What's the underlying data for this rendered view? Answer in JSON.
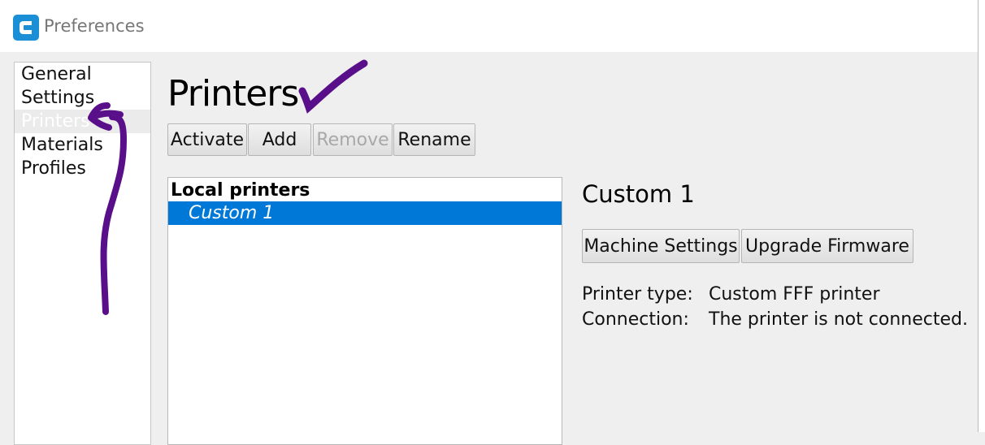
{
  "window": {
    "title": "Preferences"
  },
  "sidebar": {
    "items": [
      {
        "label": "General"
      },
      {
        "label": "Settings"
      },
      {
        "label": "Printers",
        "selected": true
      },
      {
        "label": "Materials"
      },
      {
        "label": "Profiles"
      }
    ]
  },
  "main": {
    "heading": "Printers",
    "toolbar": {
      "activate": "Activate",
      "add": "Add",
      "remove": "Remove",
      "rename": "Rename"
    },
    "list": {
      "header": "Local printers",
      "items": [
        "Custom 1"
      ]
    },
    "details": {
      "name": "Custom 1",
      "machine_settings": "Machine Settings",
      "upgrade_firmware": "Upgrade Firmware",
      "printer_type_label": "Printer type:",
      "printer_type_value": "Custom FFF printer",
      "connection_label": "Connection:",
      "connection_value": "The printer is not connected."
    }
  },
  "colors": {
    "selection": "#0078d7",
    "annotation": "#5a0f8a",
    "app_icon": "#1a8fd6"
  },
  "icons": {
    "app": "cura-logo-icon"
  }
}
